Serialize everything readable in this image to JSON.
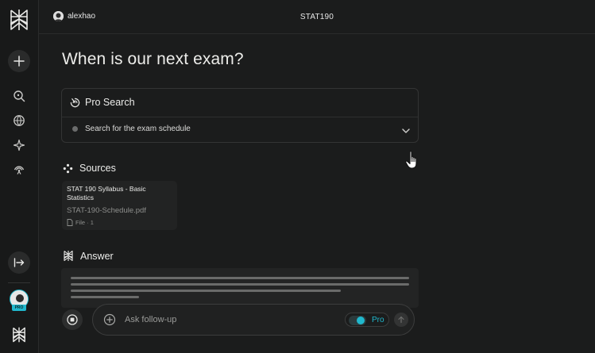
{
  "topbar": {
    "user_name": "alexhao",
    "space_title": "STAT190"
  },
  "thread": {
    "question": "When is our next exam?"
  },
  "pro_search": {
    "title": "Pro Search",
    "step": "Search for the exam schedule"
  },
  "sources": {
    "title": "Sources",
    "items": [
      {
        "title": "STAT 190 Syllabus - Basic Statistics",
        "file": "STAT-190-Schedule.pdf",
        "meta": "File · 1"
      }
    ]
  },
  "answer": {
    "title": "Answer"
  },
  "followup": {
    "placeholder": "Ask follow-up",
    "pro_label": "Pro",
    "pro_enabled": true
  },
  "sidebar": {
    "avatar_badge": "PRO"
  },
  "colors": {
    "accent": "#20b8cd",
    "background": "#1b1c1c",
    "sidebar": "#181919"
  }
}
